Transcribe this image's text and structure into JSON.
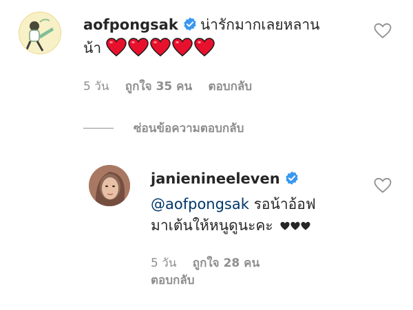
{
  "comment1": {
    "username": "aofpongsak",
    "text_line1": "น่ารักมากเลยหลาน",
    "text_line2": "น้า",
    "emojis": [
      "red-heart",
      "red-heart",
      "red-heart",
      "red-heart",
      "red-heart"
    ],
    "time": "5 วัน",
    "likes": "ถูกใจ 35 คน",
    "reply": "ตอบกลับ",
    "like_icon": "heart-outline-icon"
  },
  "hide_replies": "ซ่อนข้อความตอบกลับ",
  "comment2": {
    "username": "janienineeleven",
    "mention": "@aofpongsak",
    "text_line1_rest": " รอน้าอ้อฟ",
    "text_line2": "มาเต้นให้หนูดูนะคะ",
    "emojis": [
      "black-heart",
      "black-heart",
      "black-heart"
    ],
    "time": "5 วัน",
    "likes": "ถูกใจ 28 คน",
    "reply": "ตอบกลับ",
    "like_icon": "heart-outline-icon"
  },
  "colors": {
    "verified": "#3897f0",
    "red_heart": "#e8112d",
    "meta": "#8e8e8e",
    "mention": "#00376b"
  }
}
